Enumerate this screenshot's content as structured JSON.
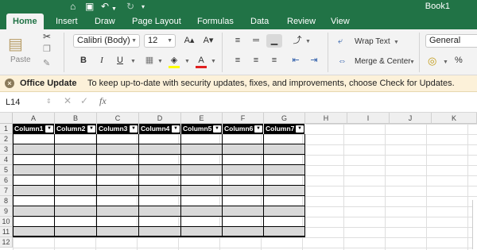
{
  "window": {
    "title": "Book1"
  },
  "tabs": [
    "Home",
    "Insert",
    "Draw",
    "Page Layout",
    "Formulas",
    "Data",
    "Review",
    "View"
  ],
  "active_tab": "Home",
  "ribbon": {
    "paste_label": "Paste",
    "font_name": "Calibri (Body)",
    "font_size": "12",
    "wrap_text": "Wrap Text",
    "merge_center": "Merge & Center",
    "number_format": "General",
    "bold": "B",
    "italic": "I",
    "underline": "U",
    "percent": "%",
    "font_color_accent": "#e02020",
    "highlight_accent": "#ffff00"
  },
  "message_bar": {
    "title": "Office Update",
    "text": "To keep up-to-date with security updates, fixes, and improvements, choose Check for Updates."
  },
  "formula_bar": {
    "name_box": "L14",
    "fx": "fx",
    "formula": ""
  },
  "grid": {
    "columns": [
      "A",
      "B",
      "C",
      "D",
      "E",
      "F",
      "G",
      "H",
      "I",
      "J",
      "K"
    ],
    "rows": [
      "1",
      "2",
      "3",
      "4",
      "5",
      "6",
      "7",
      "8",
      "9",
      "10",
      "11",
      "12"
    ],
    "table_headers": [
      "Column1",
      "Column2",
      "Column3",
      "Column4",
      "Column5",
      "Column6",
      "Column7"
    ]
  },
  "colors": {
    "brand": "#217346",
    "table_header": "#000000",
    "band": "#d9d9d9",
    "message_bg": "#fcf1d9"
  }
}
